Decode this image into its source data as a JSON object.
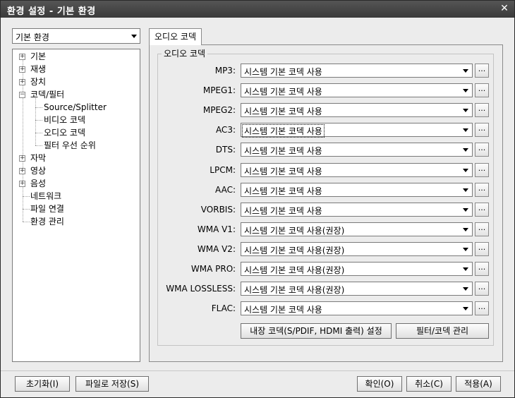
{
  "window": {
    "title": "환경 설정 - 기본 환경",
    "close_icon": "close-icon"
  },
  "category": {
    "selected": "기본 환경"
  },
  "tree": [
    {
      "label": "기본",
      "toggle": "+"
    },
    {
      "label": "재생",
      "toggle": "+"
    },
    {
      "label": "장치",
      "toggle": "+"
    },
    {
      "label": "코덱/필터",
      "toggle": "−"
    },
    {
      "label": "Source/Splitter"
    },
    {
      "label": "비디오 코덱"
    },
    {
      "label": "오디오 코덱"
    },
    {
      "label": "필터 우선 순위"
    },
    {
      "label": "자막",
      "toggle": "+"
    },
    {
      "label": "영상",
      "toggle": "+"
    },
    {
      "label": "음성",
      "toggle": "+"
    },
    {
      "label": "네트워크"
    },
    {
      "label": "파일 연결"
    },
    {
      "label": "환경 관리"
    }
  ],
  "tab": {
    "label": "오디오 코덱"
  },
  "group": {
    "label": "오디오 코덱"
  },
  "codecs": [
    {
      "label": "MP3:",
      "value": "시스템 기본 코덱 사용"
    },
    {
      "label": "MPEG1:",
      "value": "시스템 기본 코덱 사용"
    },
    {
      "label": "MPEG2:",
      "value": "시스템 기본 코덱 사용"
    },
    {
      "label": "AC3:",
      "value": "시스템 기본 코덱 사용"
    },
    {
      "label": "DTS:",
      "value": "시스템 기본 코덱 사용"
    },
    {
      "label": "LPCM:",
      "value": "시스템 기본 코덱 사용"
    },
    {
      "label": "AAC:",
      "value": "시스템 기본 코덱 사용"
    },
    {
      "label": "VORBIS:",
      "value": "시스템 기본 코덱 사용"
    },
    {
      "label": "WMA V1:",
      "value": "시스템 기본 코덱 사용(권장)"
    },
    {
      "label": "WMA V2:",
      "value": "시스템 기본 코덱 사용(권장)"
    },
    {
      "label": "WMA PRO:",
      "value": "시스템 기본 코덱 사용(권장)"
    },
    {
      "label": "WMA LOSSLESS:",
      "value": "시스템 기본 코덱 사용(권장)"
    },
    {
      "label": "FLAC:",
      "value": "시스템 기본 코덱 사용"
    }
  ],
  "more_label": "...",
  "actions": {
    "internal_codec": "내장 코덱(S/PDIF, HDMI 출력) 설정",
    "filter_manage": "필터/코덱 관리"
  },
  "footer": {
    "reset": "초기화(I)",
    "save_file": "파일로 저장(S)",
    "ok": "확인(O)",
    "cancel": "취소(C)",
    "apply": "적용(A)"
  }
}
